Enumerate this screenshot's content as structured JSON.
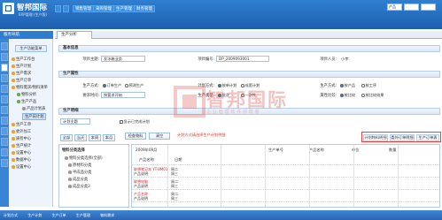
{
  "app": {
    "brand": "智邦国际",
    "subtitle": "ERP管理 (生产版)"
  },
  "topnav": {
    "items": [
      "销售管理",
      "采购管理",
      "生产管理",
      "财务管理"
    ]
  },
  "user": {
    "search_value": "产品",
    "selector": "",
    "extra": ""
  },
  "sidebar": {
    "title": "服务导航",
    "button_label": "生产功能菜单",
    "items": [
      {
        "label": "生产工作台"
      },
      {
        "label": "生产计划"
      },
      {
        "label": "生产需求"
      },
      {
        "label": "生产订单"
      },
      {
        "label": "物料需求/物料清单"
      },
      {
        "label": "物料分析"
      },
      {
        "label": "生产产品"
      },
      {
        "label": "产品计划表"
      },
      {
        "label": "生产日计划"
      },
      {
        "label": "生产工单"
      },
      {
        "label": "委外加工"
      },
      {
        "label": "质检中心"
      },
      {
        "label": "生产统计"
      },
      {
        "label": "设置中心"
      },
      {
        "label": "数据中心"
      },
      {
        "label": "设置中心"
      }
    ]
  },
  "page_tab": "生产分析",
  "basic": {
    "title": "基本信息",
    "fields": [
      {
        "label": "项目主题:",
        "value": "发冰箱业务"
      },
      {
        "label": "项目编号:",
        "value": "DP_2009093001"
      },
      {
        "label": "项目人员:",
        "value": "小李"
      }
    ]
  },
  "attrs": {
    "title": "生产属性",
    "row1_label": "生产方式:",
    "row1_opt1": "订单生产",
    "row1_opt2": "预测生产",
    "row1_label2": "计划方式:",
    "row1_opt3": "按单计划",
    "row1_opt4": "成套计划",
    "row1_label3": "生产方式:",
    "row1_opt5": "按产品",
    "row1_opt6": "按工序",
    "row2_label": "要求时间:",
    "row2_value": "按要求开始",
    "row2_label2": "生产类型:",
    "row2_opt1": "批次",
    "row2_opt2": "一次性",
    "row2_label3": "属性比较:",
    "row2_opt3": "按比较",
    "row2_opt4": "按比较结果"
  },
  "plan": {
    "title": "生产明细",
    "select_value": "计划主题",
    "checkbox_label": "显示已完成计划",
    "btn_query": "检查物料",
    "btn_clear": "清空",
    "red_link": "计划方式请选择生产计划明细",
    "tabs": [
      "计划物料明细",
      "委外订单明细",
      "生产订单表"
    ],
    "left_tabs": [
      "全部",
      "当天",
      "本周",
      "本月"
    ]
  },
  "tree2": {
    "title": "物料分类选择",
    "items": [
      "物料分类选择(全部)",
      "原材料分类",
      "半成品分类",
      "成品分类",
      "成品分类2"
    ]
  },
  "grid": {
    "headers": [
      "产品名称",
      "日期",
      "生产单号",
      "产品名称",
      "单位",
      "数量",
      "2009年09月"
    ],
    "rows": [
      {
        "name": "联想笔记本 YT-8M01",
        "desc": "产品说明",
        "d1": "周二",
        "d2": "周三"
      },
      {
        "name": "联想电脑",
        "desc": "产品说明",
        "d1": "周二",
        "d2": "周三"
      },
      {
        "name": "产品名称",
        "desc": "产品说明",
        "d1": "周二",
        "d2": "周三"
      }
    ]
  },
  "watermark": {
    "text": "智邦国际",
    "sub": "企业管理软件领跑者"
  },
  "status": {
    "items": [
      "计划方式",
      "生产计划",
      "生产订单",
      "生产管理",
      "物料需求"
    ]
  },
  "colors": {
    "primary": "#2e7dcf",
    "accent": "#e03030"
  }
}
